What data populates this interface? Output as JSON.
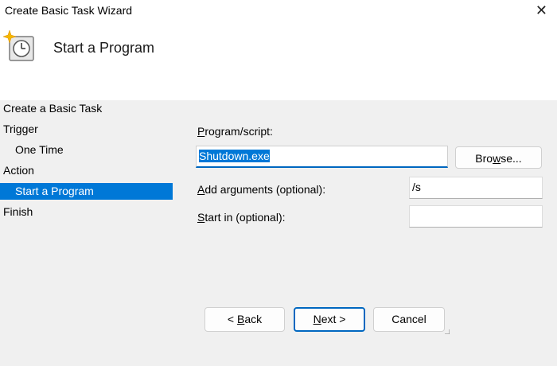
{
  "window": {
    "title": "Create Basic Task Wizard",
    "close_glyph": "✕"
  },
  "header": {
    "title": "Start a Program",
    "icon": "task-clock-icon"
  },
  "sidebar": {
    "items": [
      {
        "label": "Create a Basic Task",
        "level": 0,
        "selected": false
      },
      {
        "label": "Trigger",
        "level": 0,
        "selected": false
      },
      {
        "label": "One Time",
        "level": 1,
        "selected": false
      },
      {
        "label": "Action",
        "level": 0,
        "selected": false
      },
      {
        "label": "Start a Program",
        "level": 1,
        "selected": true
      },
      {
        "label": "Finish",
        "level": 0,
        "selected": false
      }
    ]
  },
  "form": {
    "program_label_key": "P",
    "program_label_rest": "rogram/script:",
    "program_value": "Shutdown.exe",
    "browse_label_pre": "Bro",
    "browse_label_key": "w",
    "browse_label_post": "se...",
    "args_label_key": "A",
    "args_label_rest": "dd arguments (optional):",
    "args_value": "/s",
    "startin_label_key": "S",
    "startin_label_rest": "tart in (optional):",
    "startin_value": ""
  },
  "footer": {
    "back_pre": "< ",
    "back_key": "B",
    "back_post": "ack",
    "next_key": "N",
    "next_post": "ext >",
    "cancel": "Cancel"
  },
  "colors": {
    "accent": "#0078d7",
    "focus_border": "#0067c0",
    "panel": "#f0f0f0"
  }
}
